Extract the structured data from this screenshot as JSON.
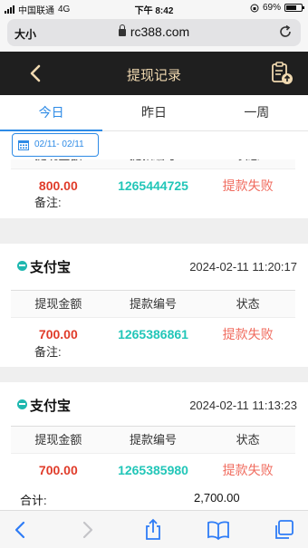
{
  "status_bar": {
    "carrier": "中国联通",
    "network": "4G",
    "time": "下午 8:42",
    "battery": "69%",
    "battery_level": 0.69
  },
  "browser": {
    "size_label": "大小",
    "url": "rc388.com"
  },
  "header": {
    "title": "提现记录"
  },
  "tabs": [
    {
      "label": "今日",
      "active": true
    },
    {
      "label": "昨日",
      "active": false
    },
    {
      "label": "一周",
      "active": false
    }
  ],
  "date_filter": {
    "range": "02/11- 02/11"
  },
  "columns": {
    "amount": "提现金额",
    "order_no": "提款编号",
    "status": "状态"
  },
  "records": [
    {
      "amount": "800.00",
      "order_no": "1265444725",
      "status": "提款失败",
      "remark_label": "备注:"
    },
    {
      "method": "支付宝",
      "time": "2024-02-11 11:20:17",
      "amount": "700.00",
      "order_no": "1265386861",
      "status": "提款失败",
      "remark_label": "备注:"
    },
    {
      "method": "支付宝",
      "time": "2024-02-11 11:13:23",
      "amount": "700.00",
      "order_no": "1265385980",
      "status": "提款失败"
    }
  ],
  "total": {
    "label": "合计:",
    "value": "2,700.00"
  }
}
